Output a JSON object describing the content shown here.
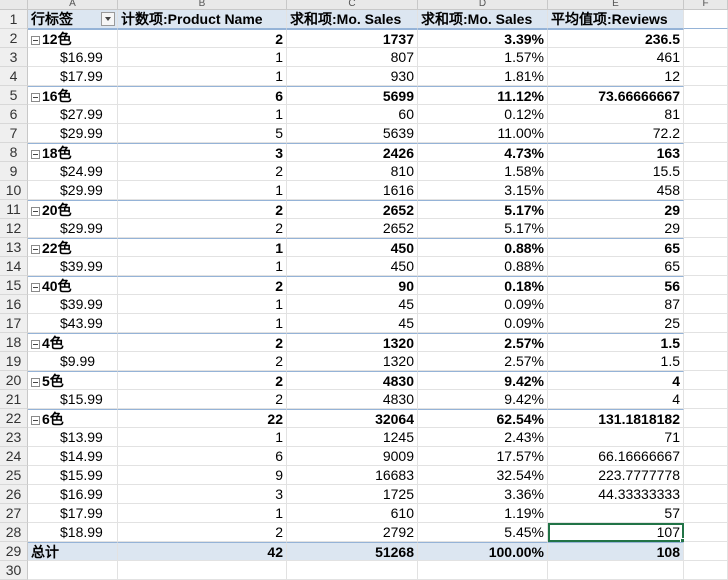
{
  "columns": [
    "A",
    "B",
    "C",
    "D",
    "E",
    "F"
  ],
  "header": {
    "row_num": "1",
    "row_labels": "行标签",
    "count_product": "计数项:Product Name",
    "sum_sales": "求和项:Mo. Sales",
    "sum_sales_pct": "求和项:Mo. Sales",
    "avg_reviews": "平均值项:Reviews"
  },
  "rows": [
    {
      "n": "2",
      "label": "12色",
      "count": "2",
      "sales": "1737",
      "pct": "3.39%",
      "reviews": "236.5",
      "type": "group"
    },
    {
      "n": "3",
      "label": "$16.99",
      "count": "1",
      "sales": "807",
      "pct": "1.57%",
      "reviews": "461",
      "type": "item"
    },
    {
      "n": "4",
      "label": "$17.99",
      "count": "1",
      "sales": "930",
      "pct": "1.81%",
      "reviews": "12",
      "type": "item"
    },
    {
      "n": "5",
      "label": "16色",
      "count": "6",
      "sales": "5699",
      "pct": "11.12%",
      "reviews": "73.66666667",
      "type": "group"
    },
    {
      "n": "6",
      "label": "$27.99",
      "count": "1",
      "sales": "60",
      "pct": "0.12%",
      "reviews": "81",
      "type": "item"
    },
    {
      "n": "7",
      "label": "$29.99",
      "count": "5",
      "sales": "5639",
      "pct": "11.00%",
      "reviews": "72.2",
      "type": "item"
    },
    {
      "n": "8",
      "label": "18色",
      "count": "3",
      "sales": "2426",
      "pct": "4.73%",
      "reviews": "163",
      "type": "group"
    },
    {
      "n": "9",
      "label": "$24.99",
      "count": "2",
      "sales": "810",
      "pct": "1.58%",
      "reviews": "15.5",
      "type": "item"
    },
    {
      "n": "10",
      "label": "$29.99",
      "count": "1",
      "sales": "1616",
      "pct": "3.15%",
      "reviews": "458",
      "type": "item"
    },
    {
      "n": "11",
      "label": "20色",
      "count": "2",
      "sales": "2652",
      "pct": "5.17%",
      "reviews": "29",
      "type": "group"
    },
    {
      "n": "12",
      "label": "$29.99",
      "count": "2",
      "sales": "2652",
      "pct": "5.17%",
      "reviews": "29",
      "type": "item"
    },
    {
      "n": "13",
      "label": "22色",
      "count": "1",
      "sales": "450",
      "pct": "0.88%",
      "reviews": "65",
      "type": "group"
    },
    {
      "n": "14",
      "label": "$39.99",
      "count": "1",
      "sales": "450",
      "pct": "0.88%",
      "reviews": "65",
      "type": "item"
    },
    {
      "n": "15",
      "label": "40色",
      "count": "2",
      "sales": "90",
      "pct": "0.18%",
      "reviews": "56",
      "type": "group"
    },
    {
      "n": "16",
      "label": "$39.99",
      "count": "1",
      "sales": "45",
      "pct": "0.09%",
      "reviews": "87",
      "type": "item"
    },
    {
      "n": "17",
      "label": "$43.99",
      "count": "1",
      "sales": "45",
      "pct": "0.09%",
      "reviews": "25",
      "type": "item"
    },
    {
      "n": "18",
      "label": "4色",
      "count": "2",
      "sales": "1320",
      "pct": "2.57%",
      "reviews": "1.5",
      "type": "group"
    },
    {
      "n": "19",
      "label": "$9.99",
      "count": "2",
      "sales": "1320",
      "pct": "2.57%",
      "reviews": "1.5",
      "type": "item"
    },
    {
      "n": "20",
      "label": "5色",
      "count": "2",
      "sales": "4830",
      "pct": "9.42%",
      "reviews": "4",
      "type": "group"
    },
    {
      "n": "21",
      "label": "$15.99",
      "count": "2",
      "sales": "4830",
      "pct": "9.42%",
      "reviews": "4",
      "type": "item"
    },
    {
      "n": "22",
      "label": "6色",
      "count": "22",
      "sales": "32064",
      "pct": "62.54%",
      "reviews": "131.1818182",
      "type": "group"
    },
    {
      "n": "23",
      "label": "$13.99",
      "count": "1",
      "sales": "1245",
      "pct": "2.43%",
      "reviews": "71",
      "type": "item"
    },
    {
      "n": "24",
      "label": "$14.99",
      "count": "6",
      "sales": "9009",
      "pct": "17.57%",
      "reviews": "66.16666667",
      "type": "item"
    },
    {
      "n": "25",
      "label": "$15.99",
      "count": "9",
      "sales": "16683",
      "pct": "32.54%",
      "reviews": "223.7777778",
      "type": "item"
    },
    {
      "n": "26",
      "label": "$16.99",
      "count": "3",
      "sales": "1725",
      "pct": "3.36%",
      "reviews": "44.33333333",
      "type": "item"
    },
    {
      "n": "27",
      "label": "$17.99",
      "count": "1",
      "sales": "610",
      "pct": "1.19%",
      "reviews": "57",
      "type": "item"
    },
    {
      "n": "28",
      "label": "$18.99",
      "count": "2",
      "sales": "2792",
      "pct": "5.45%",
      "reviews": "107",
      "type": "item",
      "selected": true
    },
    {
      "n": "29",
      "label": "总计",
      "count": "42",
      "sales": "51268",
      "pct": "100.00%",
      "reviews": "108",
      "type": "total"
    }
  ],
  "next_row": "30",
  "colors": {
    "header_fill": "#dce6f1",
    "border_blue": "#95b3d7",
    "selection": "#217346"
  }
}
